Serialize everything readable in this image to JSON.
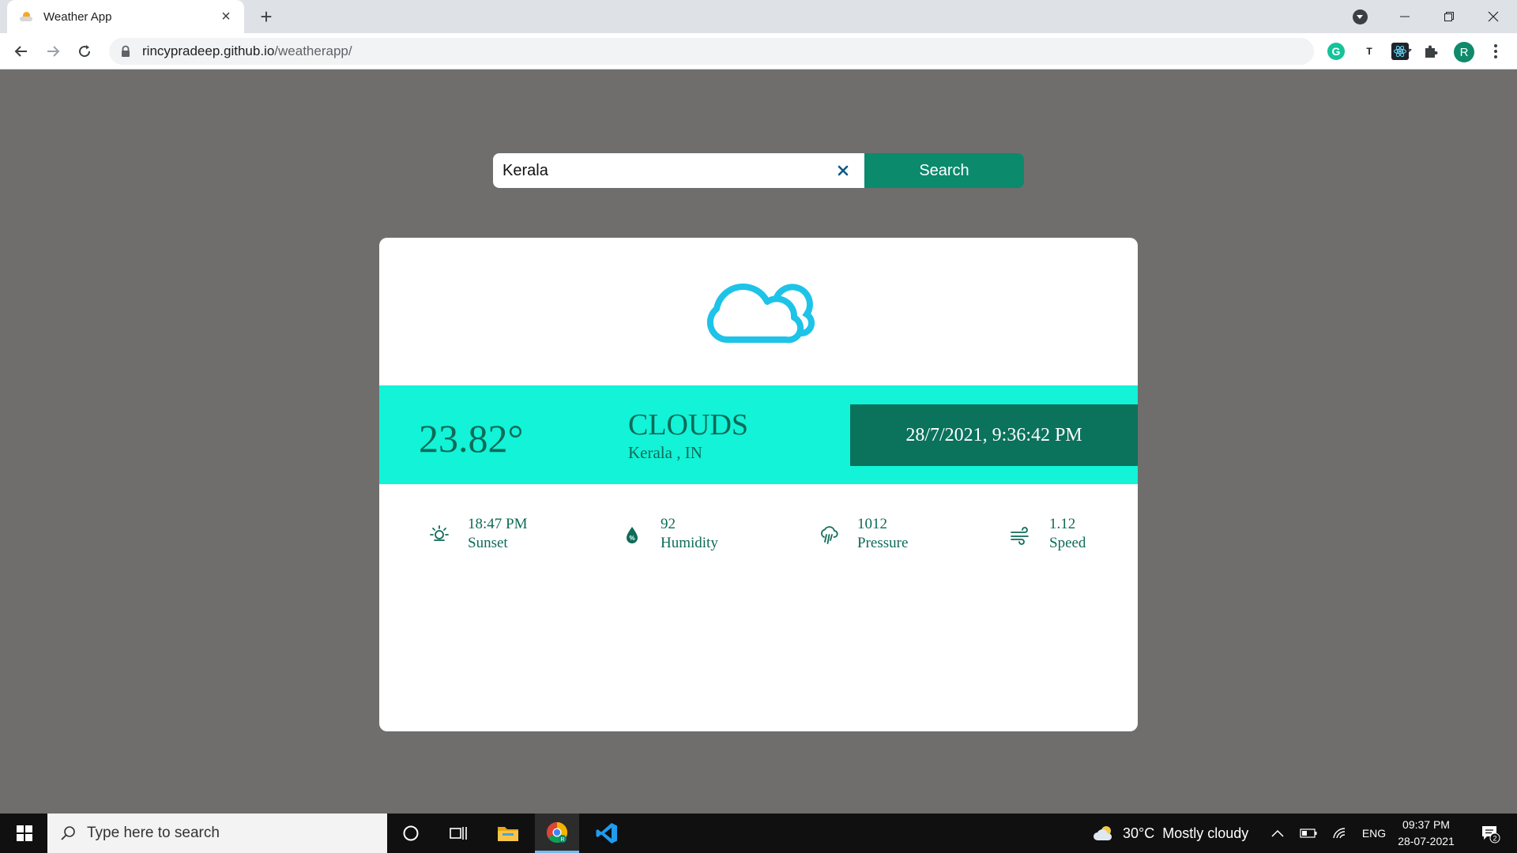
{
  "browser": {
    "tab_title": "Weather App",
    "url_host": "rincypradeep.github.io",
    "url_path": "/weatherapp/",
    "extensions": {
      "t_label": "T"
    },
    "profile_initial": "R"
  },
  "search": {
    "value": "Kerala",
    "button_label": "Search"
  },
  "weather": {
    "temperature": "23.82°",
    "condition": "CLOUDS",
    "location": "Kerala , IN",
    "datetime": "28/7/2021, 9:36:42 PM",
    "icon": "clouds-icon",
    "stats": [
      {
        "icon": "sunset-icon",
        "value": "18:47 PM",
        "label": "Sunset"
      },
      {
        "icon": "humidity-icon",
        "value": "92",
        "label": "Humidity"
      },
      {
        "icon": "pressure-icon",
        "value": "1012",
        "label": "Pressure"
      },
      {
        "icon": "wind-icon",
        "value": "1.12",
        "label": "Speed"
      }
    ]
  },
  "taskbar": {
    "search_placeholder": "Type here to search",
    "weather_text": "30°C  Mostly cloudy",
    "language": "ENG",
    "time": "09:37 PM",
    "date": "28-07-2021",
    "notification_count": "2"
  },
  "colors": {
    "page_bg": "#6f6e6d",
    "accent_dark": "#0b8a6c",
    "band": "#12f3d7",
    "date_box": "#0b725c",
    "text_teal": "#0e6b58",
    "icon_cyan": "#1ec3e8"
  }
}
